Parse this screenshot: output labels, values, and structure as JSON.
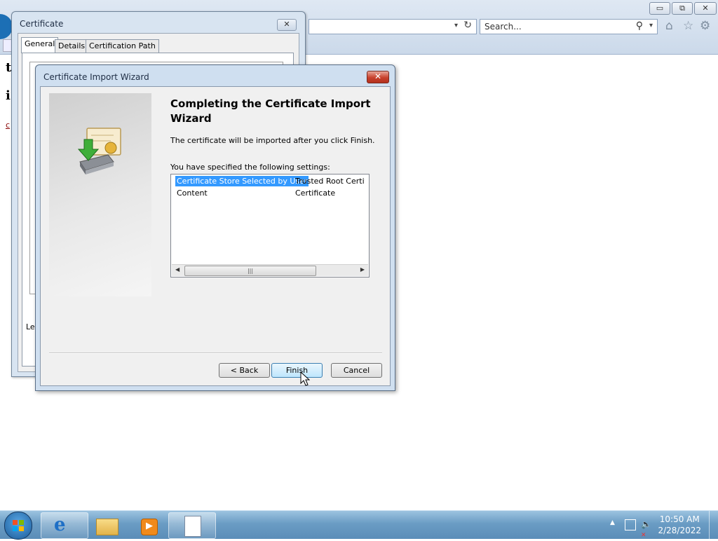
{
  "browser": {
    "search_placeholder": "Search...",
    "minimize_glyph": "▭",
    "restore_glyph": "⧉",
    "close_glyph": "✕",
    "page_text": {
      "line1": "t",
      "line2": "i",
      "line3": "c"
    },
    "icons": [
      "back-icon",
      "dropdown-icon",
      "refresh-icon",
      "search-icon",
      "home-icon",
      "favorites-icon",
      "tools-icon"
    ]
  },
  "cert_window": {
    "title": "Certificate",
    "close_glyph": "✕",
    "tabs": [
      "General",
      "Details",
      "Certification Path"
    ],
    "partial_label": "Le"
  },
  "wizard": {
    "title": "Certificate Import Wizard",
    "close_glyph": "✕",
    "heading": "Completing the Certificate Import Wizard",
    "description": "The certificate will be imported after you click Finish.",
    "settings_label": "You have specified the following settings:",
    "settings": [
      {
        "key": "Certificate Store Selected by User",
        "value": "Trusted Root Certification Authorities"
      },
      {
        "key": "Content",
        "value": "Certificate"
      }
    ],
    "buttons": {
      "back": "< Back",
      "finish": "Finish",
      "cancel": "Cancel"
    }
  },
  "taskbar": {
    "time": "10:50 AM",
    "date": "2/28/2022",
    "items": [
      "internet-explorer",
      "windows-explorer",
      "media-player",
      "document"
    ]
  },
  "colors": {
    "selection": "#3399ff",
    "close_red": "#c8412d",
    "taskbar": "#6a9cc4"
  }
}
